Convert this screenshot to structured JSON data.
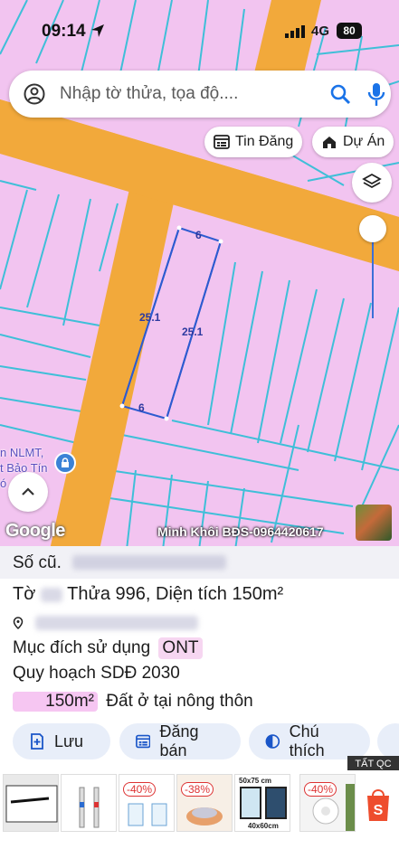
{
  "status_bar": {
    "time": "09:14",
    "network": "4G",
    "battery": "80"
  },
  "search": {
    "placeholder": "Nhập tờ thửa, tọa độ...."
  },
  "chips": {
    "tin_dang": "Tin Đăng",
    "du_an": "Dự Án"
  },
  "map": {
    "parcel_labels": {
      "top": "6",
      "bottom": "6",
      "left": "25.1",
      "middle": "25.1"
    },
    "poi_text": [
      "n NLMT,",
      "t Bảo Tín",
      "ó"
    ],
    "google_logo": "Google",
    "watermark": "Minh Khôi BĐS-0964420617"
  },
  "info": {
    "old_label": "Số cũ.",
    "sheet_prefix": "Tờ",
    "sheet_rest": " Thửa 996, Diện tích 150m²",
    "land_use_label": "Mục đích sử dụng",
    "land_use_code": "ONT",
    "planning": "Quy hoạch SDĐ 2030",
    "area_value": "150m²",
    "area_desc": "Đất ở tại nông thôn"
  },
  "actions": {
    "save": "Lưu",
    "sell": "Đăng bán",
    "note": "Chú thích"
  },
  "ads": {
    "badge": "TẤT QC",
    "discounts": [
      "-40%",
      "-38%",
      "-40%"
    ],
    "frame_size_top": "50x75 cm",
    "frame_size_bottom": "40x60cm"
  },
  "colors": {
    "road": "#f2a93b",
    "parcel_bg": "#f2c4f0",
    "parcel_line": "#3fbfd8",
    "selected": "#2d5bd0"
  }
}
